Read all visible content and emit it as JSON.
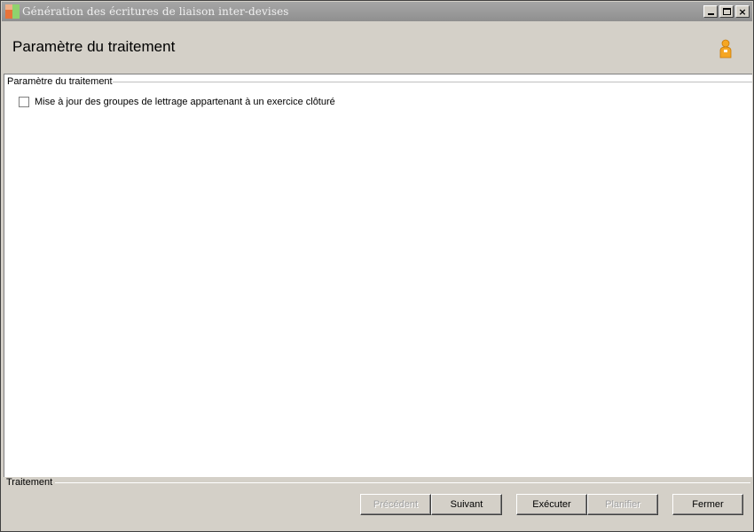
{
  "window": {
    "title": "Génération des écritures de liaison inter-devises",
    "controls": {
      "minimize": "",
      "maximize": "",
      "close": "×"
    }
  },
  "header": {
    "title": "Paramètre du traitement",
    "icon": "person-icon"
  },
  "parameters": {
    "legend": "Paramètre du traitement",
    "checkbox_label": "Mise à jour des groupes de lettrage appartenant à un exercice clôturé",
    "checkbox_checked": false
  },
  "footer": {
    "legend": "Traitement",
    "buttons": {
      "previous": "Précédent",
      "next": "Suivant",
      "execute": "Exécuter",
      "schedule": "Planifier",
      "close": "Fermer"
    }
  },
  "colors": {
    "titlebar": "#999999",
    "face": "#d4d0c8",
    "content": "#ffffff",
    "person_icon": "#f5a623"
  }
}
